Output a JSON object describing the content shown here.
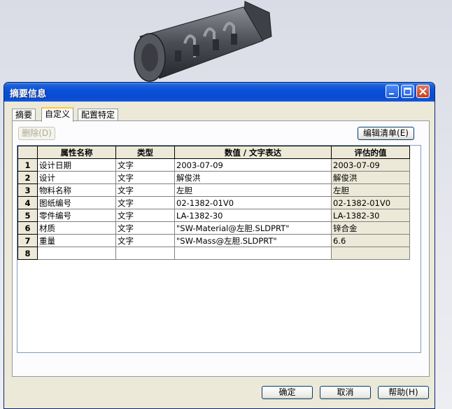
{
  "dialog": {
    "title": "摘要信息",
    "tabs": [
      "摘要",
      "自定义",
      "配置特定"
    ],
    "active_tab": 1,
    "delete_button": "删除(D)",
    "edit_list_button": "编辑清单(E)",
    "footer": {
      "ok": "确定",
      "cancel": "取消",
      "help": "帮助(H)"
    }
  },
  "table": {
    "headers": [
      "属性名称",
      "类型",
      "数值 / 文字表达",
      "评估的值"
    ],
    "rows": [
      {
        "n": "1",
        "name": "设计日期",
        "type": "文字",
        "expr": "2003-07-09",
        "value": "2003-07-09"
      },
      {
        "n": "2",
        "name": "设计",
        "type": "文字",
        "expr": "解俊洪",
        "value": "解俊洪"
      },
      {
        "n": "3",
        "name": "物料名称",
        "type": "文字",
        "expr": "左胆",
        "value": "左胆"
      },
      {
        "n": "4",
        "name": "图纸编号",
        "type": "文字",
        "expr": "02-1382-01V0",
        "value": "02-1382-01V0"
      },
      {
        "n": "5",
        "name": "零件编号",
        "type": "文字",
        "expr": "LA-1382-30",
        "value": "LA-1382-30"
      },
      {
        "n": "6",
        "name": "材质",
        "type": "文字",
        "expr": "\"SW-Material@左胆.SLDPRT\"",
        "value": "锌合金"
      },
      {
        "n": "7",
        "name": "重量",
        "type": "文字",
        "expr": "\"SW-Mass@左胆.SLDPRT\"",
        "value": "6.6"
      },
      {
        "n": "8",
        "name": "",
        "type": "",
        "expr": "",
        "value": ""
      }
    ]
  },
  "colors": {
    "titlebar": "#0a50d8",
    "dialog_bg": "#ece9d8",
    "tab_highlight": "#ffc83c"
  }
}
